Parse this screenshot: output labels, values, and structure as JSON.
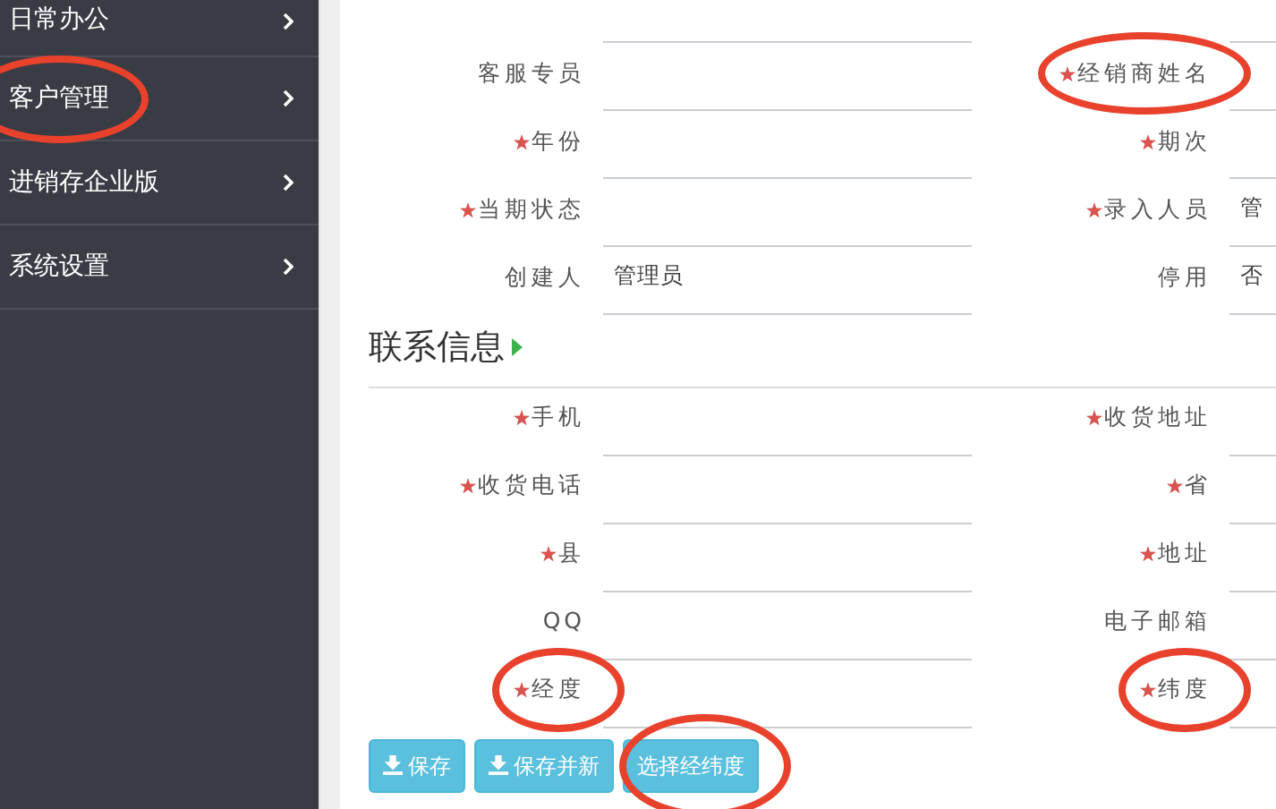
{
  "sidebar": {
    "items": [
      {
        "label": "日常办公",
        "circled": false
      },
      {
        "label": "客户管理",
        "circled": true
      },
      {
        "label": "进销存企业版",
        "circled": false
      },
      {
        "label": "系统设置",
        "circled": false
      }
    ]
  },
  "basic_rows": [
    [
      {
        "label": "客服专员",
        "required": false,
        "circled": false
      },
      {
        "label": "经销商姓名",
        "required": true,
        "circled": true
      }
    ],
    [
      {
        "label": "年份",
        "required": true,
        "circled": false
      },
      {
        "label": "期次",
        "required": true,
        "circled": false
      }
    ],
    [
      {
        "label": "当期状态",
        "required": true,
        "circled": false
      },
      {
        "label": "录入人员",
        "required": true,
        "value": "管",
        "circled": false
      }
    ],
    [
      {
        "label": "创建人",
        "required": false,
        "value": "管理员",
        "circled": false
      },
      {
        "label": "停用",
        "required": false,
        "value": "否",
        "circled": false
      }
    ]
  ],
  "contact": {
    "title": "联系信息",
    "rows": [
      [
        {
          "label": "手机",
          "required": true,
          "circled": false
        },
        {
          "label": "收货地址",
          "required": true,
          "circled": false
        }
      ],
      [
        {
          "label": "收货电话",
          "required": true,
          "circled": false
        },
        {
          "label": "省",
          "required": true,
          "circled": false
        }
      ],
      [
        {
          "label": "县",
          "required": true,
          "circled": false
        },
        {
          "label": "地址",
          "required": true,
          "circled": false
        }
      ],
      [
        {
          "label": "QQ",
          "required": false,
          "circled": false
        },
        {
          "label": "电子邮箱",
          "required": false,
          "circled": false
        }
      ],
      [
        {
          "label": "经度",
          "required": true,
          "circled": true
        },
        {
          "label": "纬度",
          "required": true,
          "circled": true
        }
      ]
    ]
  },
  "buttons": [
    {
      "label": "保存",
      "kind": "icon-text",
      "circled": false
    },
    {
      "label": "保存并新",
      "kind": "icon-text",
      "circled": false
    },
    {
      "label": "选择经纬度",
      "kind": "text",
      "circled": true
    }
  ]
}
